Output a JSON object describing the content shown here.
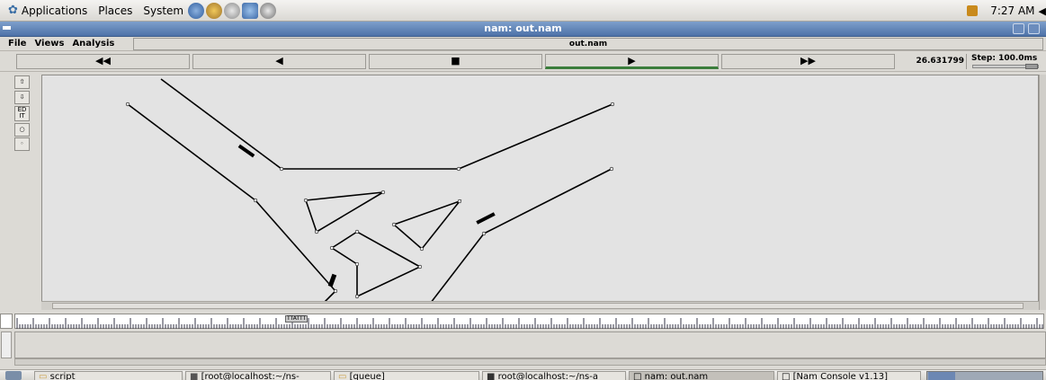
{
  "top_panel": {
    "menus": [
      "Applications",
      "Places",
      "System"
    ],
    "clock": "7:27 AM"
  },
  "window": {
    "title": "nam: out.nam"
  },
  "menubar": {
    "items": [
      "File",
      "Views",
      "Analysis"
    ],
    "file_label": "out.nam"
  },
  "controls": {
    "rewind": "◀◀",
    "back": "◀",
    "stop": "■",
    "play": "▶",
    "fast_forward": "▶▶",
    "time": "26.631799",
    "step": "Step: 100.0ms"
  },
  "tools": {
    "edit_label": "ED IT"
  },
  "timeline": {
    "marker_label": "TTATTT"
  },
  "taskbar": {
    "tasks": [
      "script",
      "[root@localhost:~/ns-",
      "[queue]",
      "root@localhost:~/ns-a",
      "nam: out.nam",
      "[Nam Console v1.13]"
    ]
  },
  "colors": {
    "titlebar": "#5b7fb5",
    "canvas": "#e3e3e3",
    "link": "#000000",
    "play_indicator": "#3b7d3b"
  }
}
